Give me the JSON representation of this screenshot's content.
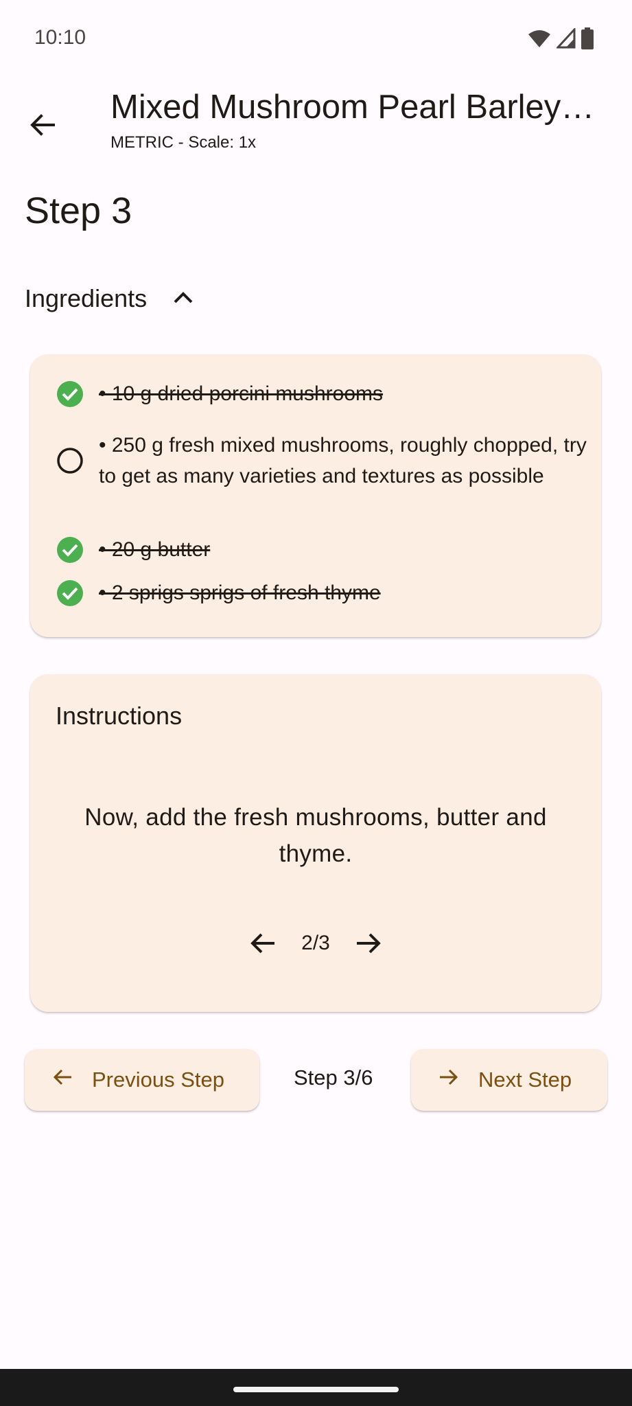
{
  "status_bar": {
    "time": "10:10",
    "icons": [
      "wifi-icon",
      "signal-icon",
      "battery-icon"
    ]
  },
  "app_bar": {
    "back_icon": "arrow-back-icon",
    "title": "Mixed Mushroom Pearl Barley ...",
    "subtitle": "METRIC - Scale: 1x"
  },
  "step": {
    "heading": "Step 3"
  },
  "ingredients": {
    "label": "Ingredients",
    "expanded": true,
    "toggle_icon": "chevron-up-icon",
    "items": [
      {
        "text": "• 10 g dried porcini mushrooms",
        "checked": true
      },
      {
        "text": "• 250 g fresh mixed mushrooms, roughly chopped, try to get as many varieties and textures as possible",
        "checked": false
      },
      {
        "text": "• 20 g butter",
        "checked": true
      },
      {
        "text": "• 2 sprigs sprigs of fresh thyme",
        "checked": true
      }
    ]
  },
  "instructions": {
    "title": "Instructions",
    "text": "Now, add the fresh mushrooms, butter and thyme.",
    "pager_label": "2/3"
  },
  "navigation": {
    "previous_label": "Previous Step",
    "next_label": "Next Step",
    "step_counter": "Step 3/6"
  },
  "colors": {
    "background": "#fffbff",
    "card": "#fdeee3",
    "accent": "#7b4f0e",
    "check_green": "#4caf50",
    "text": "#201a17"
  }
}
